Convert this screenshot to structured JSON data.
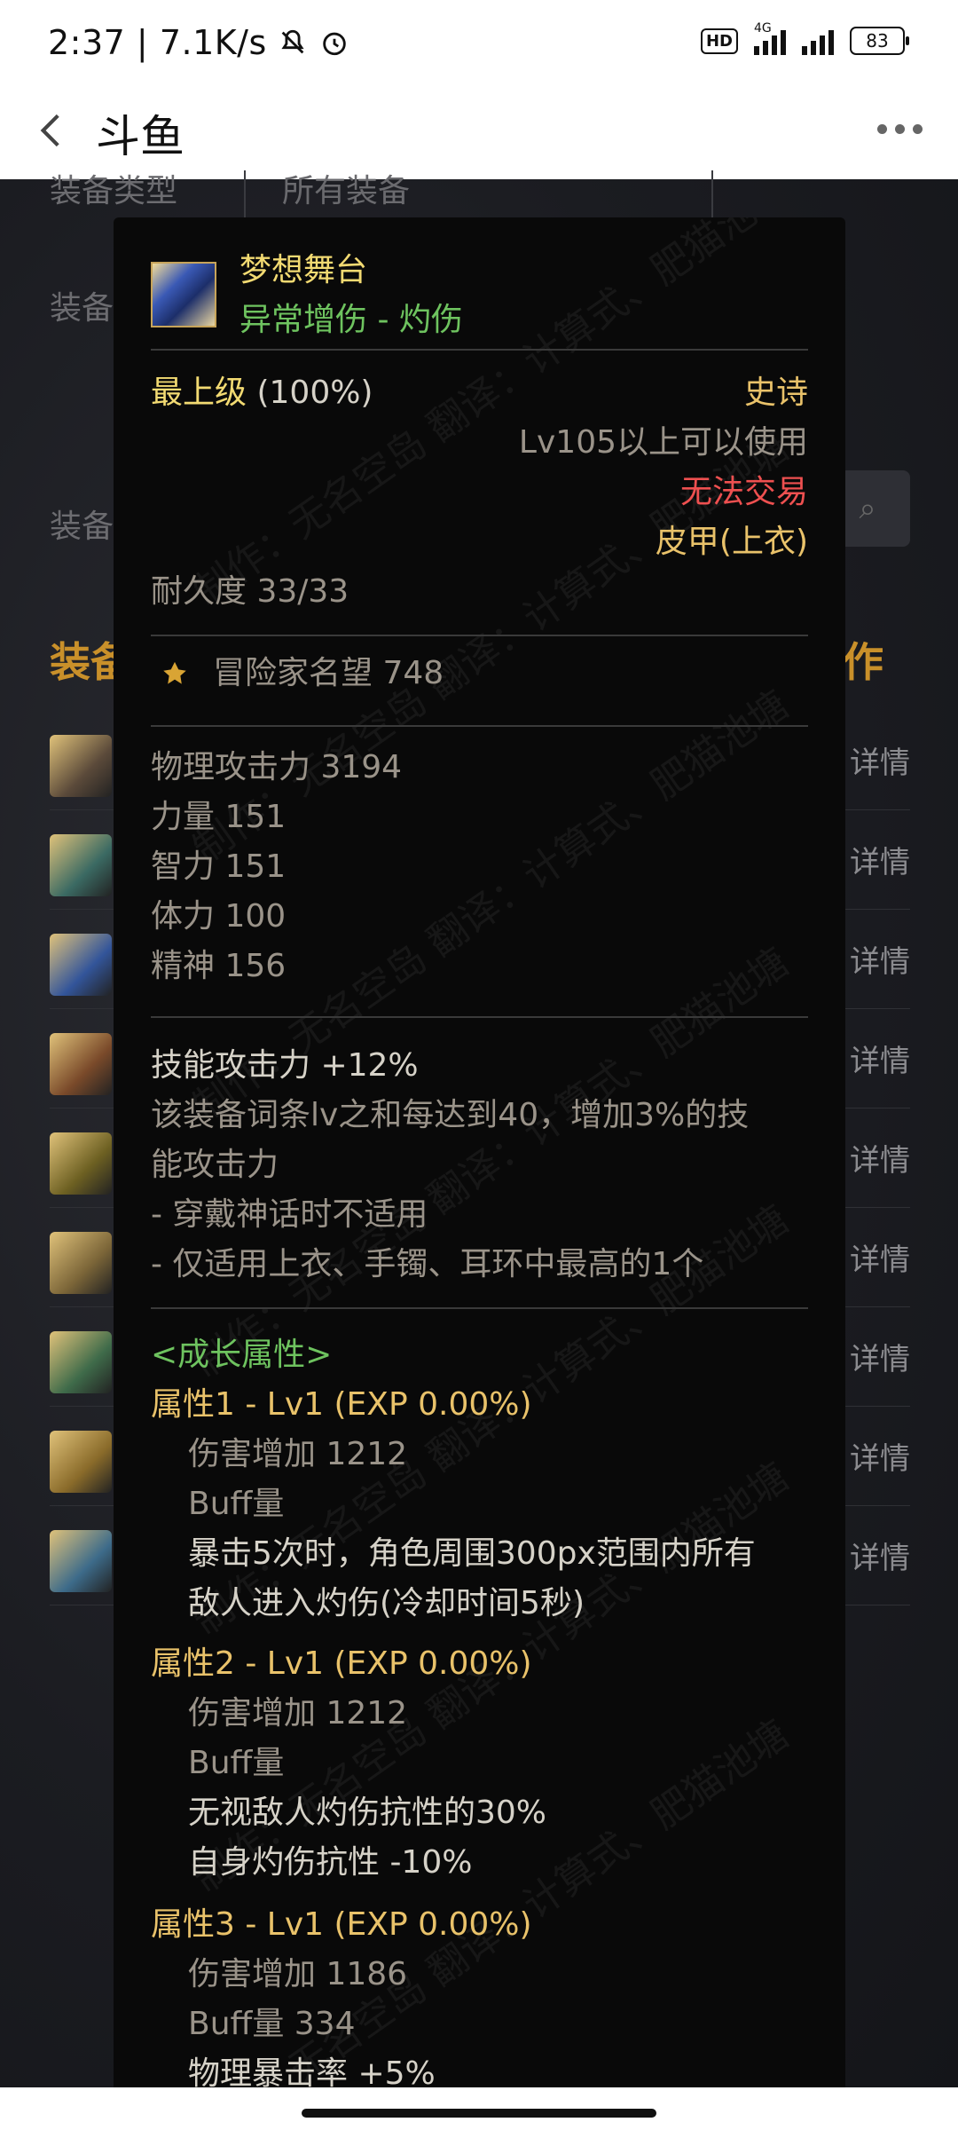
{
  "status": {
    "time": "2:37",
    "speed": "7.1K/s",
    "hd": "HD",
    "network": "4G",
    "battery": "83"
  },
  "header": {
    "title": "斗鱼"
  },
  "background": {
    "label_type": "装备类型",
    "value_type": "所有装备",
    "label_b": "装备",
    "label_c": "装备",
    "heading_left": "装备",
    "heading_right": "作",
    "detail": "详情",
    "rows": 9
  },
  "item": {
    "name": "梦想舞台",
    "subtype": "异常增伤 - 灼伤",
    "grade": "最上级",
    "grade_pct": "(100%)",
    "rarity": "史诗",
    "level_req": "Lv105以上可以使用",
    "trade": "无法交易",
    "slot": "皮甲(上衣)",
    "durability": "耐久度 33/33",
    "fame": "冒险家名望 748",
    "stats": [
      "物理攻击力  3194",
      "力量  151",
      "智力  151",
      "体力  100",
      "精神  156"
    ],
    "skill_atk": "技能攻击力  +12%",
    "skill_desc_1": "该装备词条lv之和每达到40，增加3%的技",
    "skill_desc_2": "能攻击力",
    "skill_note_1": "- 穿戴神话时不适用",
    "skill_note_2": "- 仅适用上衣、手镯、耳环中最高的1个",
    "growth_title": "<成长属性>",
    "attr1": {
      "title": "属性1 - Lv1 (EXP 0.00%)",
      "dmg": "伤害增加  1212",
      "buff": "Buff量",
      "effect_1": "暴击5次时，角色周围300px范围内所有",
      "effect_2": "敌人进入灼伤(冷却时间5秒)"
    },
    "attr2": {
      "title": "属性2 - Lv1 (EXP 0.00%)",
      "dmg": "伤害增加  1212",
      "buff": "Buff量",
      "effect_1": "无视敌人灼伤抗性的30%",
      "effect_2": "自身灼伤抗性 -10%"
    },
    "attr3": {
      "title": "属性3 - Lv1 (EXP 0.00%)",
      "dmg": "伤害增加  1186",
      "buff": "Buff量  334",
      "effect_1": "物理暴击率 +5%"
    }
  },
  "watermark": "制作：无名空岛 翻译：计算式、肥猫池塘"
}
